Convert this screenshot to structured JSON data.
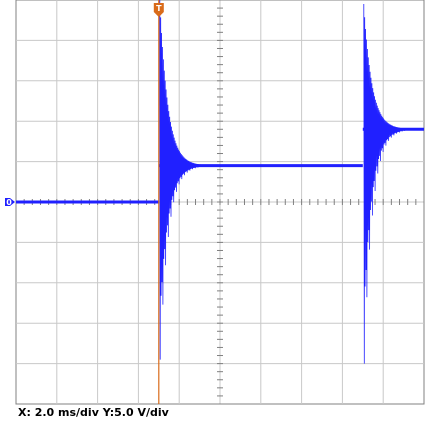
{
  "chart_data": {
    "type": "line",
    "title": "",
    "xlabel": "",
    "ylabel": "",
    "x_divisions": 10,
    "y_divisions": 10,
    "x_per_div": "2.0 ms/div",
    "y_per_div": "5.0 V/div",
    "xlim": [
      -10,
      10
    ],
    "ylim": [
      -25,
      25
    ],
    "grid": true,
    "legend": "none",
    "trigger": {
      "label": "T",
      "x": -3.0
    },
    "ground_marker": {
      "label": "0",
      "y": 0
    },
    "series": [
      {
        "color": "#2020ff",
        "baseline_segments": [
          {
            "x_start": -10.0,
            "x_end": -3.0,
            "level": 0.0
          },
          {
            "x_start": -3.0,
            "x_end": 7.0,
            "level": 4.5
          },
          {
            "x_start": 7.0,
            "x_end": 10.0,
            "level": 9.0
          }
        ],
        "ringing_events": [
          {
            "x": -3.0,
            "peak_high": 25.0,
            "peak_low": -19.5,
            "settle_level": 4.5
          },
          {
            "x": 7.0,
            "peak_high": 24.5,
            "peak_low": -20.0,
            "settle_level": 9.0
          }
        ]
      }
    ]
  },
  "status": {
    "x_scale": "X: 2.0 ms/div",
    "y_scale": "Y:5.0 V/div"
  },
  "colors": {
    "grid": "#c8c8c8",
    "axis": "#808080",
    "trace": "#2020ff",
    "trigger": "#d96b1a",
    "ground": "#2020ff"
  }
}
